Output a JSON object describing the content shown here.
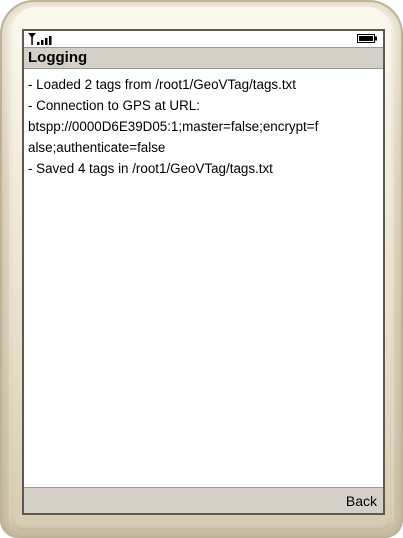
{
  "status": {
    "signal_icon": "signal-strength-icon",
    "battery_icon": "battery-icon"
  },
  "title": "Logging",
  "log_lines": [
    "- Loaded 2 tags from /root1/GeoVTag/tags.txt",
    "- Connection to GPS at URL:",
    "btspp://0000D6E39D05:1;master=false;encrypt=f",
    "alse;authenticate=false",
    "- Saved 4 tags in /root1/GeoVTag/tags.txt"
  ],
  "softkeys": {
    "right": "Back"
  },
  "colors": {
    "bar_background": "#d4d0c8",
    "screen_background": "#ffffff"
  }
}
